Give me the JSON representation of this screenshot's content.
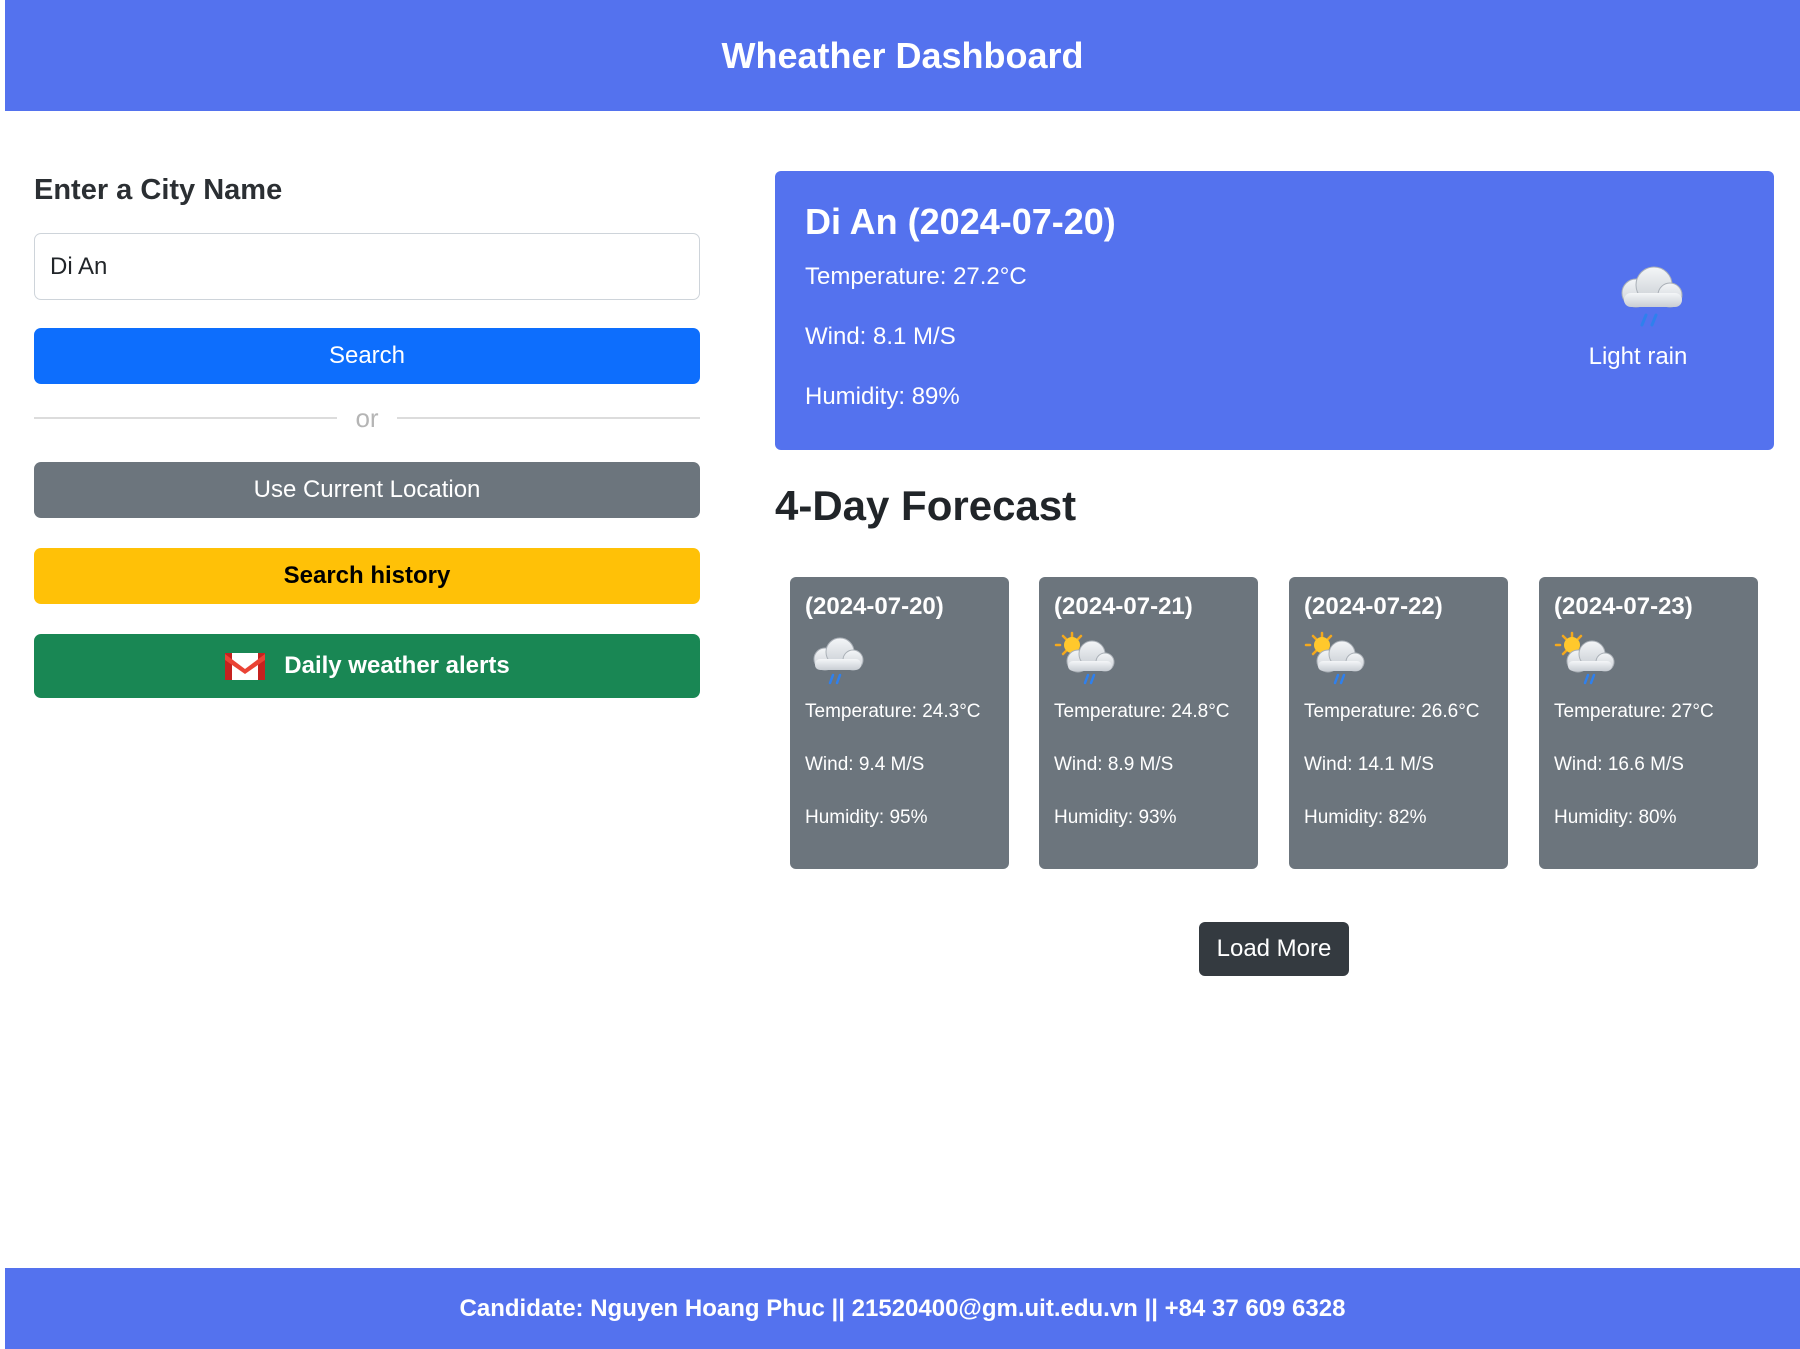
{
  "header": {
    "title": "Wheather Dashboard"
  },
  "search": {
    "label": "Enter a City Name",
    "value": "Di An",
    "search_button": "Search",
    "or_text": "or",
    "location_button": "Use Current Location",
    "history_button": "Search history",
    "alerts_button": "Daily weather alerts",
    "alerts_icon": "gmail-icon"
  },
  "current": {
    "title": "Di An (2024-07-20)",
    "temperature": "Temperature: 27.2°C",
    "wind": "Wind: 8.1 M/S",
    "humidity": "Humidity: 89%",
    "icon": "rain-cloud-icon",
    "description": "Light rain"
  },
  "forecast": {
    "title": "4-Day Forecast",
    "days": [
      {
        "date": "(2024-07-20)",
        "icon": "rain-cloud-icon",
        "temperature": "Temperature: 24.3°C",
        "wind": "Wind: 9.4 M/S",
        "humidity": "Humidity: 95%"
      },
      {
        "date": "(2024-07-21)",
        "icon": "sun-rain-cloud-icon",
        "temperature": "Temperature: 24.8°C",
        "wind": "Wind: 8.9 M/S",
        "humidity": "Humidity: 93%"
      },
      {
        "date": "(2024-07-22)",
        "icon": "sun-rain-cloud-icon",
        "temperature": "Temperature: 26.6°C",
        "wind": "Wind: 14.1 M/S",
        "humidity": "Humidity: 82%"
      },
      {
        "date": "(2024-07-23)",
        "icon": "sun-rain-cloud-icon",
        "temperature": "Temperature: 27°C",
        "wind": "Wind: 16.6 M/S",
        "humidity": "Humidity: 80%"
      }
    ],
    "load_more": "Load More"
  },
  "footer": {
    "text": "Candidate: Nguyen Hoang Phuc || 21520400@gm.uit.edu.vn || +84 37 609 6328"
  },
  "colors": {
    "primary": "#5472ee",
    "search_button": "#0d6efd",
    "location_button": "#6c757d",
    "history_button": "#ffc107",
    "alerts_button": "#198754",
    "card_bg": "#6c757d",
    "load_more": "#343a40"
  }
}
